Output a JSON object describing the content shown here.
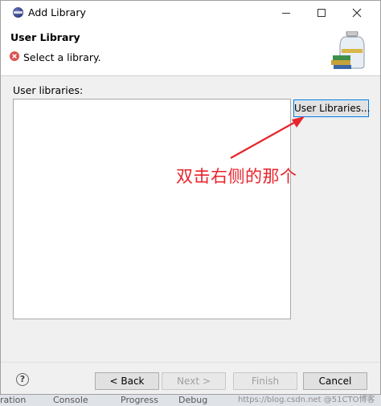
{
  "window": {
    "title": "Add Library"
  },
  "header": {
    "page_title": "User Library",
    "message": "Select a library."
  },
  "main": {
    "libraries_label": "User libraries:",
    "user_libraries_button": "User Libraries...",
    "annotation_text": "双击右侧的那个",
    "annotation_color": "#e8242c"
  },
  "footer": {
    "help_icon_text": "?",
    "back": "< Back",
    "next": "Next >",
    "finish": "Finish",
    "cancel": "Cancel"
  },
  "background_window": {
    "tabs": [
      "ration",
      "Console",
      "Progress",
      "Debug"
    ],
    "watermark": "https://blog.csdn.net @51CTO博客"
  },
  "icons": {
    "app": "eclipse-icon",
    "error": "error-icon",
    "banner": "library-jar-icon",
    "help": "help-icon"
  },
  "colors": {
    "focus_border": "#0078d7",
    "error": "#d9534f"
  }
}
